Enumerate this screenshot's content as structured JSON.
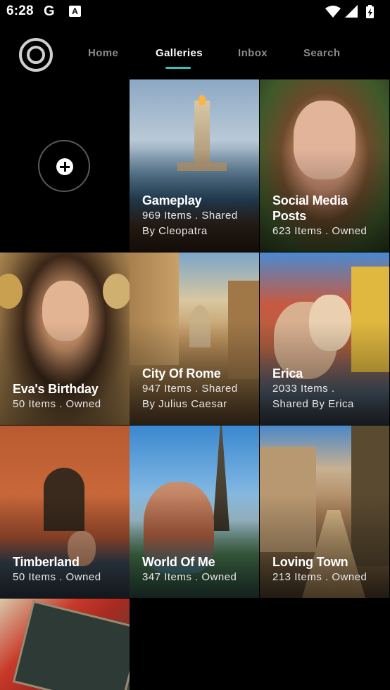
{
  "status_bar": {
    "time": "6:28",
    "icons": [
      "google-g-icon",
      "text-a-icon",
      "wifi-icon",
      "signal-icon",
      "battery-charging-icon"
    ]
  },
  "nav": {
    "tabs": [
      {
        "label": "Home",
        "active": false
      },
      {
        "label": "Galleries",
        "active": true
      },
      {
        "label": "Inbox",
        "active": false
      },
      {
        "label": "Search",
        "active": false
      }
    ],
    "accent_color": "#2ec4c4"
  },
  "galleries": [
    {
      "title": "Gameplay",
      "meta1": "969 Items . Shared",
      "meta2": "By Cleopatra"
    },
    {
      "title": "Social Media",
      "title2": "Posts",
      "meta1": "623 Items . Owned"
    },
    {
      "title": "Eva's Birthday",
      "meta1": "50 Items . Owned"
    },
    {
      "title": "City Of Rome",
      "meta1": "947 Items . Shared",
      "meta2": "By Julius Caesar"
    },
    {
      "title": "Erica",
      "meta1": "2033 Items .",
      "meta2": "Shared By Erica"
    },
    {
      "title": "Timberland",
      "meta1": "50 Items . Owned"
    },
    {
      "title": "World Of Me",
      "meta1": "347 Items . Owned"
    },
    {
      "title": "Loving Town",
      "meta1": "213 Items . Owned"
    },
    {
      "title": ""
    }
  ]
}
